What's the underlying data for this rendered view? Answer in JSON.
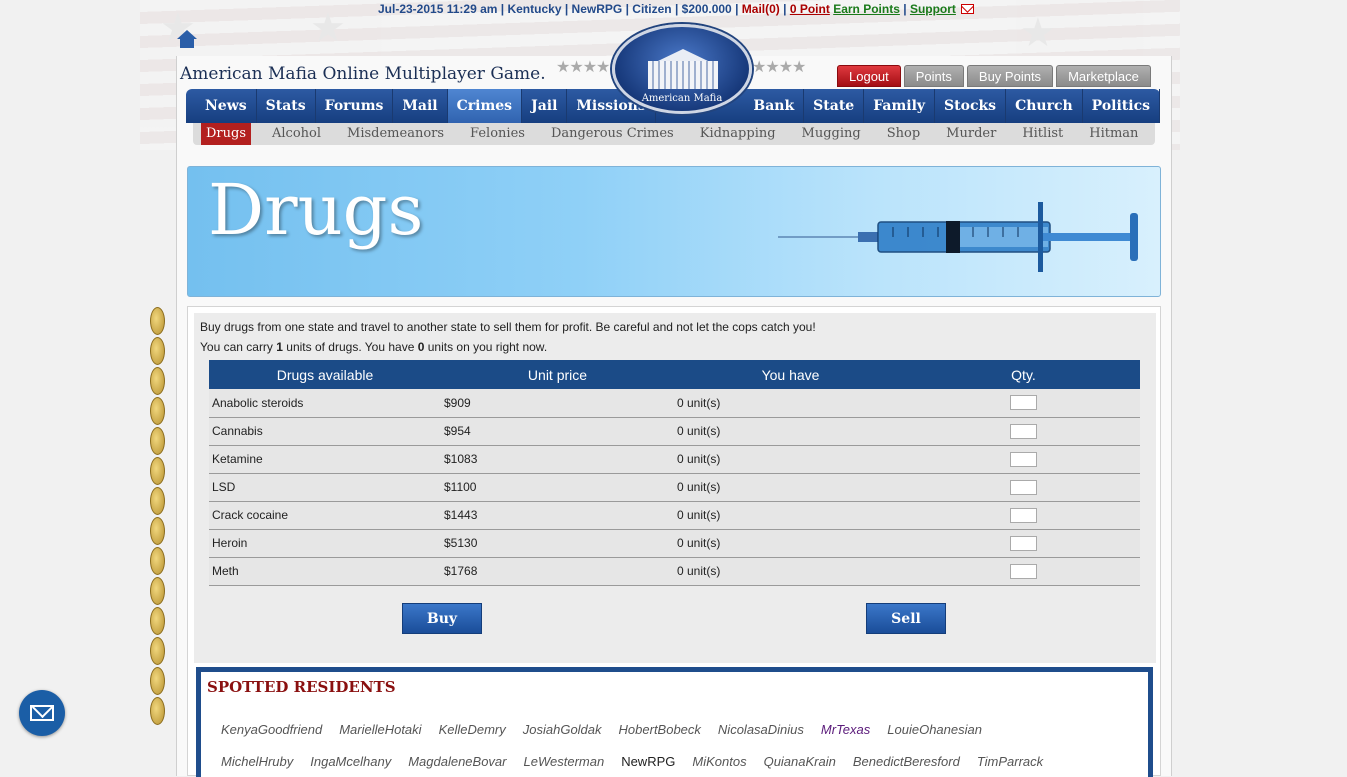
{
  "topbar": {
    "date": "Jul-23-2015 11:29 am",
    "state": "Kentucky",
    "user": "NewRPG",
    "rank": "Citizen",
    "money": "$200.000",
    "mail": "Mail(0)",
    "points": "0 Point",
    "earn": "Earn Points",
    "support": "Support",
    "sep": "|"
  },
  "site": {
    "title": "American Mafia Online Multiplayer Game.",
    "logo_caption": "American Mafia",
    "stars": "★★★★"
  },
  "topbuttons": [
    "Logout",
    "Points",
    "Buy Points",
    "Marketplace"
  ],
  "mainnav": {
    "left": [
      "News",
      "Stats",
      "Forums",
      "Mail",
      "Crimes",
      "Jail",
      "Missions"
    ],
    "right": [
      "Bank",
      "State",
      "Family",
      "Stocks",
      "Church",
      "Politics"
    ],
    "active": "Crimes"
  },
  "subnav": [
    "Drugs",
    "Alcohol",
    "Misdemeanors",
    "Felonies",
    "Dangerous Crimes",
    "Kidnapping",
    "Mugging",
    "Shop",
    "Murder",
    "Hitlist",
    "Hitman"
  ],
  "banner": {
    "title": "Drugs"
  },
  "intro": {
    "line1": "Buy drugs from one state and travel to another state to sell them for profit. Be careful and not let the cops catch you!",
    "line2_a": "You can carry ",
    "carry": "1",
    "line2_b": " units of drugs. You have ",
    "have": "0",
    "line2_c": " units on you right now."
  },
  "table": {
    "headers": [
      "Drugs available",
      "Unit price",
      "You have",
      "Qty."
    ],
    "rows": [
      {
        "name": "Anabolic steroids",
        "price": "$909",
        "have": "0 unit(s)"
      },
      {
        "name": "Cannabis",
        "price": "$954",
        "have": "0 unit(s)"
      },
      {
        "name": "Ketamine",
        "price": "$1083",
        "have": "0 unit(s)"
      },
      {
        "name": "LSD",
        "price": "$1100",
        "have": "0 unit(s)"
      },
      {
        "name": "Crack cocaine",
        "price": "$1443",
        "have": "0 unit(s)"
      },
      {
        "name": "Heroin",
        "price": "$5130",
        "have": "0 unit(s)"
      },
      {
        "name": "Meth",
        "price": "$1768",
        "have": "0 unit(s)"
      }
    ]
  },
  "actions": {
    "buy": "Buy",
    "sell": "Sell"
  },
  "spotted": {
    "heading": "SPOTTED RESIDENTS",
    "row1": [
      "KenyaGoodfriend",
      "MarielleHotaki",
      "KelleDemry",
      "JosiahGoldak",
      "HobertBobeck",
      "NicolasaDinius",
      "MrTexas",
      "LouieOhanesian"
    ],
    "row2": [
      "MichelHruby",
      "IngaMcelhany",
      "MagdaleneBovar",
      "LeWesterman",
      "NewRPG",
      "MiKontos",
      "QuianaKrain",
      "BenedictBeresford",
      "TimParrack"
    ]
  }
}
